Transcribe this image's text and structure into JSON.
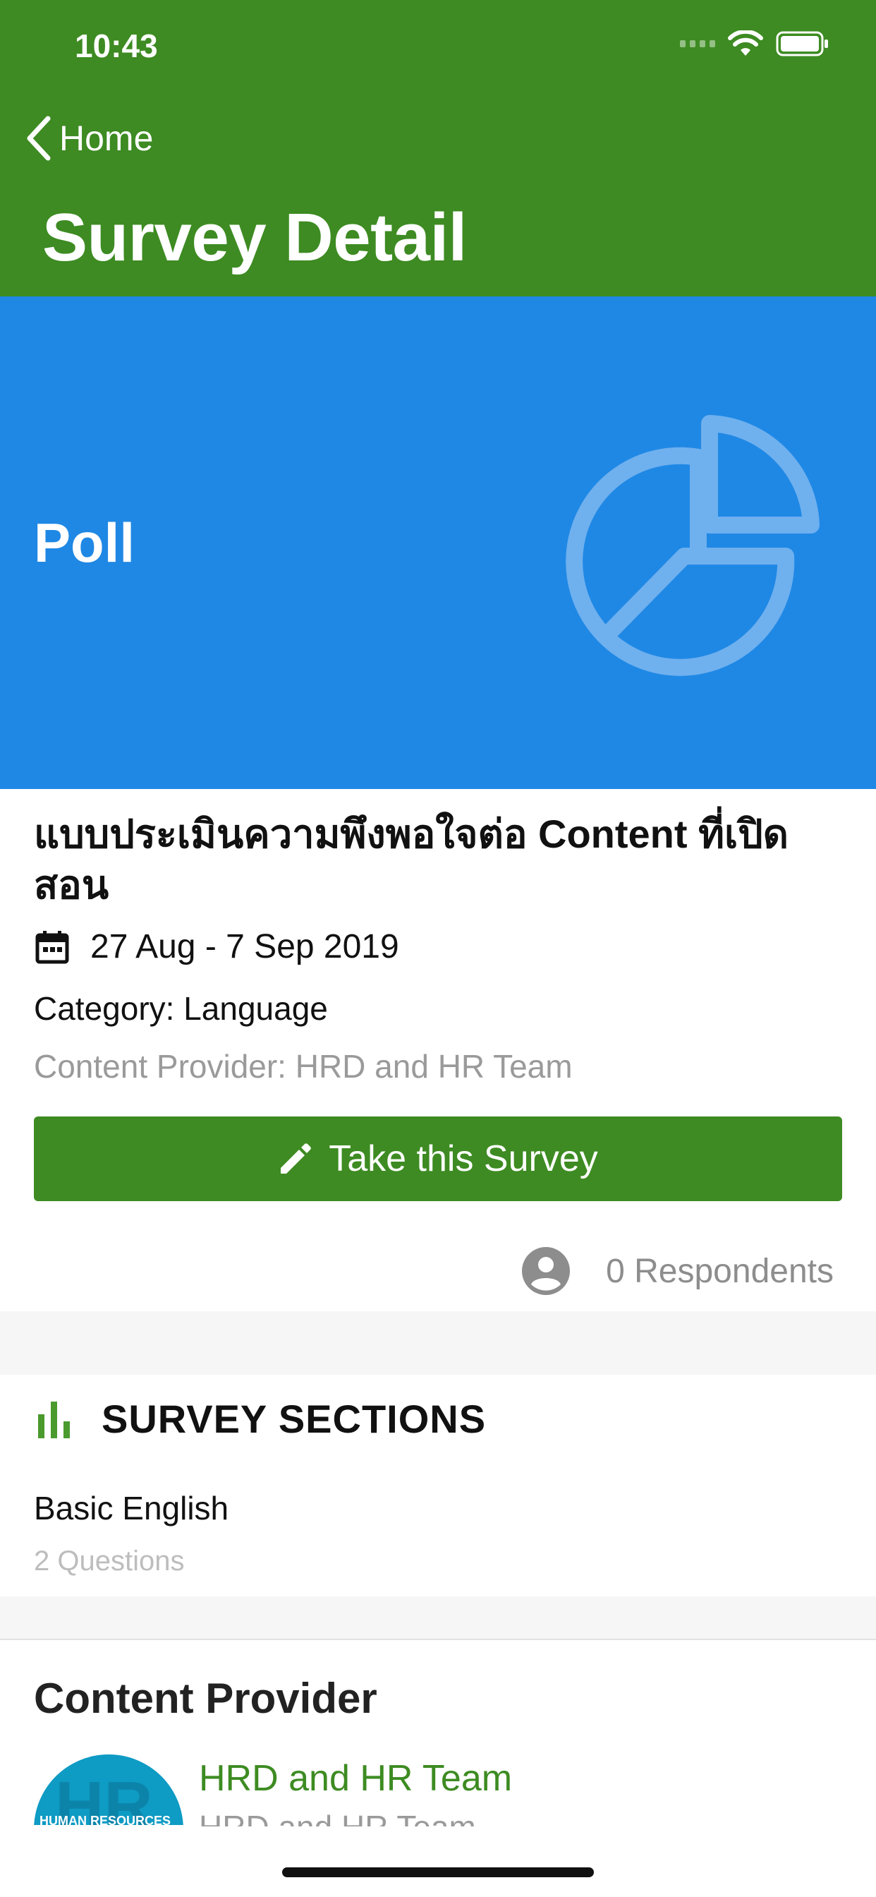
{
  "status_bar": {
    "time": "10:43"
  },
  "nav": {
    "back_label": "Home",
    "title": "Survey Detail"
  },
  "banner": {
    "type_label": "Poll",
    "icon": "pie-chart-icon"
  },
  "survey": {
    "title": "แบบประเมินความพึงพอใจต่อ Content ที่เปิดสอน",
    "date_range": "27 Aug - 7 Sep 2019",
    "category": "Category: Language",
    "content_provider": "Content Provider: HRD and HR Team",
    "take_button_label": "Take this Survey",
    "respondents": "0 Respondents"
  },
  "sections": {
    "heading": "SURVEY SECTIONS",
    "items": [
      {
        "name": "Basic English",
        "questions": "2 Questions"
      }
    ]
  },
  "provider": {
    "heading": "Content Provider",
    "name": "HRD and HR Team",
    "subtitle": "HRD and HR Team",
    "avatar_text": "HUMAN RESOURCES"
  },
  "colors": {
    "header_green": "#3d8b22",
    "banner_blue": "#1f88e5",
    "button_green": "#3d8b22"
  }
}
